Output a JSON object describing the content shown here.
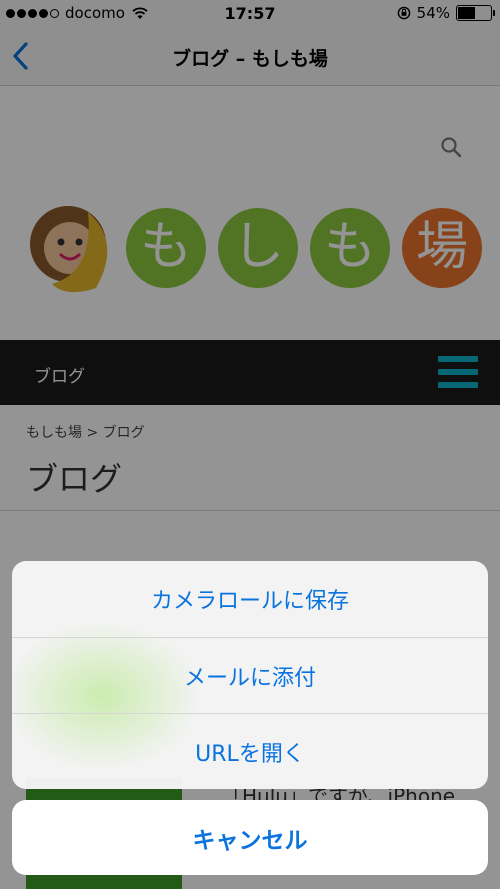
{
  "status_bar": {
    "carrier": "docomo",
    "time": "17:57",
    "battery_text": "54%",
    "battery_level": 0.54,
    "signal_bars_filled": 4,
    "signal_bars_total": 5
  },
  "nav_bar": {
    "title": "ブログ – もしも場",
    "back_icon": "chevron-left-icon"
  },
  "page": {
    "logo_chars": [
      "も",
      "し",
      "も",
      "場"
    ],
    "site_nav_label": "ブログ",
    "breadcrumb": "もしも場 > ブログ",
    "heading": "ブログ",
    "peek_text": "「Hulu」ですが、iPhone"
  },
  "action_sheet": {
    "actions": [
      {
        "label": "カメラロールに保存"
      },
      {
        "label": "メールに添付"
      },
      {
        "label": "URLを開く"
      }
    ],
    "cancel_label": "キャンセル"
  },
  "colors": {
    "ios_blue": "#0a73e0",
    "logo_green": "#8cc63f",
    "logo_orange": "#e8732d",
    "menu_teal": "#0fb1c8",
    "site_nav_bg": "#1a1a1a"
  }
}
